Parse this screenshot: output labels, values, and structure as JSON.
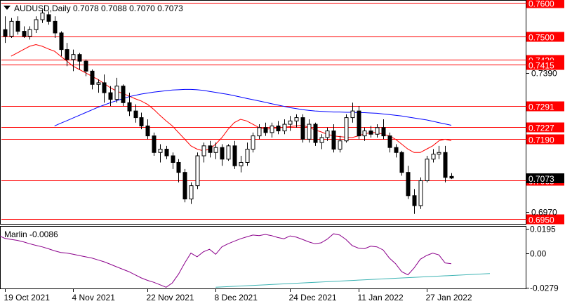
{
  "header": {
    "symbol_line": "AUDUSD,Daily  0.7078 0.7088 0.7070 0.7073"
  },
  "colors": {
    "background": "#ffffff",
    "frame": "#000000",
    "level_line": "#ff0000",
    "level_label_bg": "#ff0000",
    "level_label_text": "#ffffff",
    "ma_fast": "#ff0000",
    "ma_slow": "#0000ff",
    "oscillator": "#8b008b",
    "trendline": "#3cb3b3",
    "candle_bull_fill": "#ffffff",
    "candle_bear_fill": "#000000",
    "grid_tick": "#000000"
  },
  "price_axis": {
    "ticks": [
      "0.7390",
      "0.6970"
    ],
    "current_price_tag": "0.7073"
  },
  "levels": [
    {
      "price": 0.76,
      "label": "0.7600"
    },
    {
      "price": 0.75,
      "label": "0.7500"
    },
    {
      "price": 0.743,
      "label": "0.7430"
    },
    {
      "price": 0.7415,
      "label": "0.7415"
    },
    {
      "price": 0.7291,
      "label": "0.7291"
    },
    {
      "price": 0.7227,
      "label": "0.7227"
    },
    {
      "price": 0.719,
      "label": "0.7190"
    },
    {
      "price": 0.7065,
      "label": "0.7065"
    },
    {
      "price": 0.695,
      "label": "0.6950"
    }
  ],
  "date_axis": {
    "labels": [
      "19 Oct 2021",
      "4 Nov 2021",
      "22 Nov 2021",
      "8 Dec 2021",
      "24 Dec 2021",
      "11 Jan 2022",
      "27 Jan 2022"
    ]
  },
  "indicator": {
    "title": "Marlin -0.0086",
    "ticks": [
      "0.0195",
      "0.00",
      "-0.0279"
    ]
  },
  "chart_data": {
    "type": "candlestick",
    "symbol": "AUDUSD",
    "timeframe": "Daily",
    "ylim": [
      0.6935,
      0.7605
    ],
    "candles": [
      [
        0.752,
        0.756,
        0.748,
        0.75
      ],
      [
        0.75,
        0.7555,
        0.7495,
        0.7545
      ],
      [
        0.7545,
        0.756,
        0.7505,
        0.7515
      ],
      [
        0.7515,
        0.753,
        0.7495,
        0.75
      ],
      [
        0.75,
        0.753,
        0.749,
        0.752
      ],
      [
        0.752,
        0.756,
        0.751,
        0.755
      ],
      [
        0.755,
        0.758,
        0.754,
        0.757
      ],
      [
        0.7565,
        0.7575,
        0.7535,
        0.7545
      ],
      [
        0.7545,
        0.756,
        0.7495,
        0.751
      ],
      [
        0.751,
        0.7515,
        0.744,
        0.746
      ],
      [
        0.746,
        0.748,
        0.741,
        0.743
      ],
      [
        0.743,
        0.746,
        0.7395,
        0.7445
      ],
      [
        0.7445,
        0.745,
        0.74,
        0.7425
      ],
      [
        0.7425,
        0.743,
        0.738,
        0.7395
      ],
      [
        0.7395,
        0.74,
        0.734,
        0.7355
      ],
      [
        0.7355,
        0.737,
        0.733,
        0.736
      ],
      [
        0.736,
        0.7385,
        0.73,
        0.733
      ],
      [
        0.733,
        0.735,
        0.729,
        0.731
      ],
      [
        0.731,
        0.7375,
        0.73,
        0.735
      ],
      [
        0.735,
        0.7355,
        0.729,
        0.73
      ],
      [
        0.73,
        0.733,
        0.726,
        0.7275
      ],
      [
        0.7275,
        0.7295,
        0.724,
        0.7255
      ],
      [
        0.7255,
        0.727,
        0.722,
        0.723
      ],
      [
        0.723,
        0.725,
        0.719,
        0.72
      ],
      [
        0.72,
        0.721,
        0.714,
        0.715
      ],
      [
        0.715,
        0.7175,
        0.712,
        0.716
      ],
      [
        0.716,
        0.717,
        0.713,
        0.714
      ],
      [
        0.714,
        0.715,
        0.71,
        0.712
      ],
      [
        0.712,
        0.713,
        0.706,
        0.709
      ],
      [
        0.709,
        0.71,
        0.7,
        0.701
      ],
      [
        0.701,
        0.706,
        0.6995,
        0.705
      ],
      [
        0.705,
        0.715,
        0.704,
        0.714
      ],
      [
        0.714,
        0.718,
        0.712,
        0.717
      ],
      [
        0.717,
        0.7185,
        0.7135,
        0.715
      ],
      [
        0.715,
        0.718,
        0.713,
        0.7165
      ],
      [
        0.7165,
        0.7175,
        0.711,
        0.713
      ],
      [
        0.713,
        0.7175,
        0.7125,
        0.717
      ],
      [
        0.717,
        0.7185,
        0.71,
        0.711
      ],
      [
        0.711,
        0.714,
        0.709,
        0.712
      ],
      [
        0.712,
        0.718,
        0.711,
        0.716
      ],
      [
        0.716,
        0.721,
        0.715,
        0.72
      ],
      [
        0.72,
        0.7235,
        0.719,
        0.7225
      ],
      [
        0.7225,
        0.724,
        0.72,
        0.721
      ],
      [
        0.721,
        0.724,
        0.7195,
        0.723
      ],
      [
        0.723,
        0.7245,
        0.7205,
        0.7215
      ],
      [
        0.7215,
        0.725,
        0.7205,
        0.7235
      ],
      [
        0.7235,
        0.726,
        0.7215,
        0.7245
      ],
      [
        0.7245,
        0.7265,
        0.7225,
        0.7255
      ],
      [
        0.7255,
        0.7265,
        0.718,
        0.719
      ],
      [
        0.719,
        0.725,
        0.718,
        0.7235
      ],
      [
        0.7235,
        0.724,
        0.717,
        0.718
      ],
      [
        0.718,
        0.7205,
        0.716,
        0.7195
      ],
      [
        0.7195,
        0.7225,
        0.7185,
        0.7215
      ],
      [
        0.7215,
        0.7235,
        0.715,
        0.716
      ],
      [
        0.716,
        0.72,
        0.715,
        0.7185
      ],
      [
        0.7185,
        0.7265,
        0.718,
        0.7255
      ],
      [
        0.7255,
        0.73,
        0.724,
        0.7275
      ],
      [
        0.7275,
        0.729,
        0.719,
        0.72
      ],
      [
        0.72,
        0.7225,
        0.7185,
        0.7215
      ],
      [
        0.7215,
        0.723,
        0.7195,
        0.7205
      ],
      [
        0.7205,
        0.7235,
        0.7195,
        0.7225
      ],
      [
        0.7225,
        0.725,
        0.719,
        0.72
      ],
      [
        0.72,
        0.721,
        0.715,
        0.7165
      ],
      [
        0.7165,
        0.7175,
        0.7135,
        0.715
      ],
      [
        0.715,
        0.7155,
        0.708,
        0.709
      ],
      [
        0.709,
        0.711,
        0.701,
        0.702
      ],
      [
        0.702,
        0.704,
        0.6965,
        0.699
      ],
      [
        0.699,
        0.7075,
        0.698,
        0.7065
      ],
      [
        0.7065,
        0.714,
        0.706,
        0.713
      ],
      [
        0.713,
        0.716,
        0.712,
        0.7145
      ],
      [
        0.7145,
        0.717,
        0.713,
        0.715
      ],
      [
        0.715,
        0.717,
        0.706,
        0.7075
      ],
      [
        0.7078,
        0.7088,
        0.707,
        0.7073
      ]
    ],
    "series": [
      {
        "label": "fast MA",
        "values": [
          0.744,
          0.745,
          0.746,
          0.747,
          0.7475,
          0.747,
          0.7462,
          0.7455,
          0.744,
          0.7425,
          0.741,
          0.74,
          0.739,
          0.738,
          0.737,
          0.7358,
          0.7345,
          0.7335,
          0.7328,
          0.732,
          0.7312,
          0.7305,
          0.7295,
          0.728,
          0.7262,
          0.7245,
          0.723,
          0.721,
          0.719,
          0.717,
          0.716,
          0.7155,
          0.716,
          0.7175,
          0.7195,
          0.722,
          0.724,
          0.725,
          0.7245,
          0.7235,
          0.7225,
          0.722,
          0.7222,
          0.7224,
          0.7226,
          0.7228,
          0.723,
          0.7232,
          0.7226,
          0.7218,
          0.7212,
          0.7205,
          0.72,
          0.7198,
          0.7196,
          0.7195,
          0.72,
          0.7206,
          0.721,
          0.721,
          0.7205,
          0.72,
          0.719,
          0.7175,
          0.716,
          0.715,
          0.715,
          0.716,
          0.717,
          0.7185,
          0.719,
          0.7185
        ]
      },
      {
        "label": "slow MA",
        "values": [
          0.723,
          0.7238,
          0.7246,
          0.7254,
          0.7262,
          0.727,
          0.7278,
          0.7286,
          0.7293,
          0.73,
          0.7306,
          0.7312,
          0.7318,
          0.7322,
          0.7326,
          0.7329,
          0.7332,
          0.7334,
          0.7336,
          0.7338,
          0.7339,
          0.734,
          0.734,
          0.7339,
          0.7337,
          0.7334,
          0.7331,
          0.7328,
          0.7325,
          0.7321,
          0.7317,
          0.7313,
          0.7309,
          0.7305,
          0.7301,
          0.7297,
          0.7293,
          0.7289,
          0.7285,
          0.7282,
          0.7279,
          0.7277,
          0.7275,
          0.7274,
          0.7273,
          0.7272,
          0.7272,
          0.7271,
          0.7271,
          0.727,
          0.727,
          0.7269,
          0.7268,
          0.7266,
          0.7264,
          0.7262,
          0.726,
          0.7257,
          0.7254,
          0.7251,
          0.7248,
          0.7244,
          0.724,
          0.7236,
          0.7232
        ]
      },
      {
        "label": "Marlin",
        "values": [
          0.014,
          0.015,
          0.0148,
          0.0135,
          0.015,
          0.016,
          0.0158,
          0.014,
          0.0118,
          0.011,
          0.0102,
          0.009,
          0.0075,
          0.0062,
          0.005,
          0.0035,
          0.0018,
          0.0005,
          0.0,
          -0.001,
          -0.002,
          -0.003,
          -0.004,
          -0.0055,
          -0.007,
          -0.009,
          -0.011,
          -0.013,
          -0.015,
          -0.0175,
          -0.02,
          -0.022,
          -0.0235,
          -0.0255,
          -0.0275,
          -0.024,
          -0.017,
          -0.008,
          0.0,
          -0.003,
          0.001,
          0.003,
          -0.001,
          0.005,
          0.0075,
          0.0095,
          0.0115,
          0.013,
          0.0145,
          0.014,
          0.015,
          0.014,
          0.0125,
          0.0115,
          0.0138,
          0.0128,
          0.011,
          0.009,
          0.0075,
          0.0082,
          0.0112,
          0.0155,
          0.0145,
          0.011,
          0.006,
          0.004,
          0.0035,
          0.0055,
          0.005,
          0.0025,
          -0.004,
          -0.0085,
          -0.015,
          -0.0175,
          -0.012,
          -0.005,
          -0.002,
          0.0,
          -0.0015,
          -0.008,
          -0.0086
        ]
      }
    ],
    "indicator_ylim": [
      -0.0279,
      0.0195
    ]
  }
}
